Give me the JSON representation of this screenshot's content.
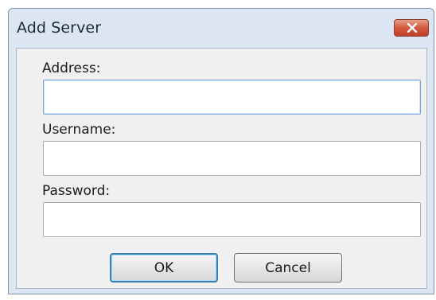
{
  "dialog": {
    "title": "Add Server",
    "close_label": "X"
  },
  "form": {
    "address": {
      "label": "Address:",
      "value": "",
      "placeholder": ""
    },
    "username": {
      "label": "Username:",
      "value": "",
      "placeholder": ""
    },
    "password": {
      "label": "Password:",
      "value": "",
      "placeholder": ""
    }
  },
  "buttons": {
    "ok_label": "OK",
    "cancel_label": "Cancel"
  },
  "colors": {
    "titlebar": "#dbe6f2",
    "close_button": "#c9492f",
    "focus_border": "#7aa8d8",
    "default_button_border": "#3c7fb1"
  }
}
